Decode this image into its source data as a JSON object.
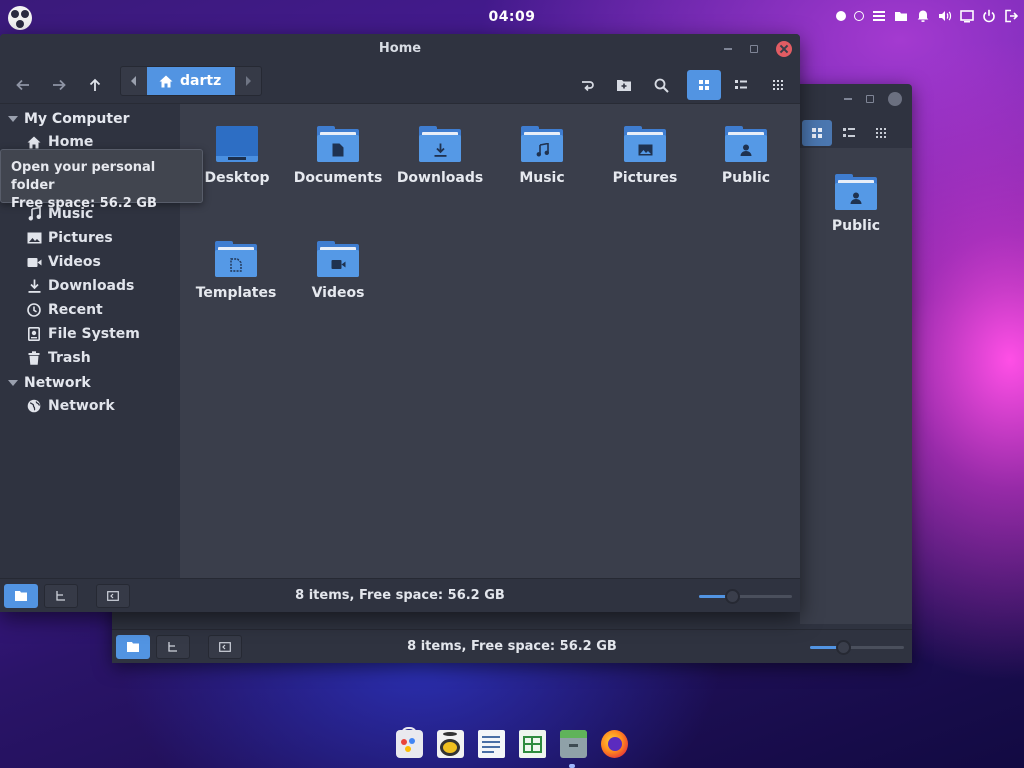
{
  "topbar": {
    "clock": "04:09",
    "icons": [
      "dot-full-icon",
      "dot-empty-icon",
      "menu-icon",
      "folder-icon",
      "bell-icon",
      "volume-icon",
      "display-icon",
      "power-icon",
      "logout-icon"
    ]
  },
  "window": {
    "title": "Home",
    "path": {
      "crumb": "dartz"
    },
    "status": "8 items, Free space: 56.2 GB"
  },
  "sidebar": {
    "sections": [
      {
        "label": "My Computer"
      },
      {
        "label": "Network"
      }
    ],
    "items": [
      {
        "label": "Home",
        "icon": "home-icon"
      },
      {
        "label": "Music",
        "icon": "music-icon"
      },
      {
        "label": "Pictures",
        "icon": "pictures-icon"
      },
      {
        "label": "Videos",
        "icon": "videos-icon"
      },
      {
        "label": "Downloads",
        "icon": "download-icon"
      },
      {
        "label": "Recent",
        "icon": "recent-icon"
      },
      {
        "label": "File System",
        "icon": "drive-icon"
      },
      {
        "label": "Trash",
        "icon": "trash-icon"
      },
      {
        "label": "Network",
        "icon": "globe-icon"
      }
    ]
  },
  "tooltip": {
    "line1": "Open your personal folder",
    "line2": "Free space: 56.2 GB"
  },
  "files": [
    {
      "name": "Desktop",
      "icon": "desktop-folder-icon"
    },
    {
      "name": "Documents",
      "icon": "documents-folder-icon"
    },
    {
      "name": "Downloads",
      "icon": "downloads-folder-icon"
    },
    {
      "name": "Music",
      "icon": "music-folder-icon"
    },
    {
      "name": "Pictures",
      "icon": "pictures-folder-icon"
    },
    {
      "name": "Public",
      "icon": "public-folder-icon"
    },
    {
      "name": "Templates",
      "icon": "templates-folder-icon"
    },
    {
      "name": "Videos",
      "icon": "videos-folder-icon"
    }
  ],
  "back_window": {
    "visible_file": "Public",
    "status": "8 items, Free space: 56.2 GB"
  },
  "zoom": {
    "level": 0.35
  },
  "dock": {
    "apps": [
      "software-store-icon",
      "music-player-icon",
      "text-document-icon",
      "spreadsheet-icon",
      "archive-manager-icon",
      "firefox-icon"
    ]
  },
  "colors": {
    "accent": "#5294e2",
    "close": "#e25c63",
    "window_bg": "#3a3e4b",
    "sidebar_bg": "#2f3340"
  }
}
